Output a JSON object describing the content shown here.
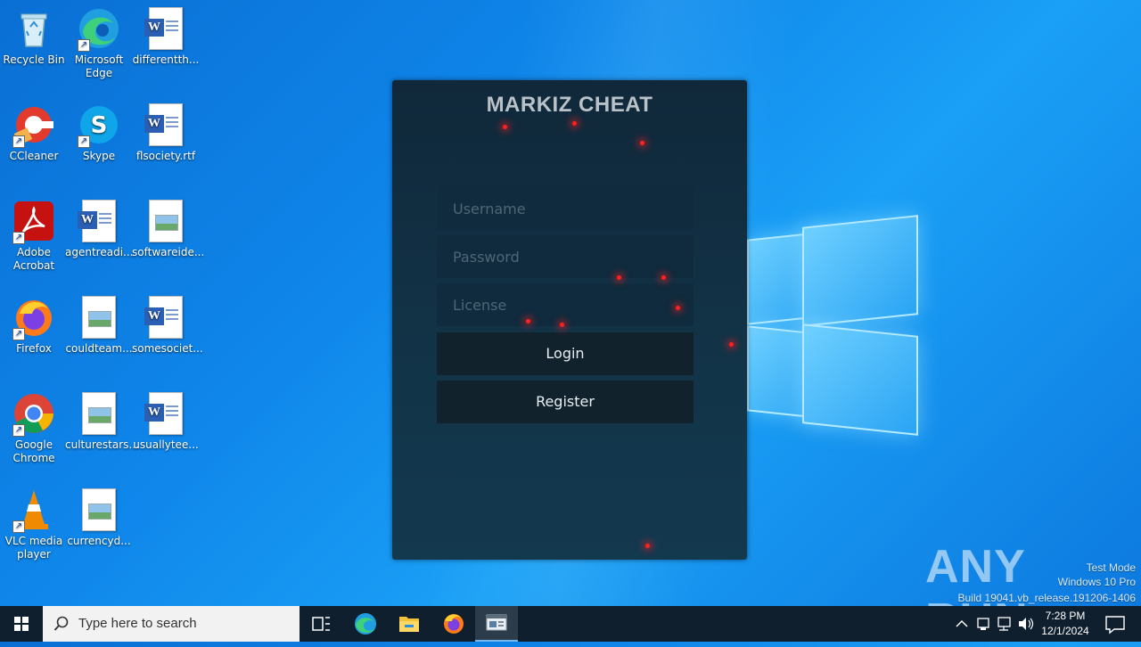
{
  "desktop": {
    "icons": [
      {
        "label": "Recycle Bin"
      },
      {
        "label": "Microsoft Edge"
      },
      {
        "label": "differentth..."
      },
      {
        "label": "CCleaner"
      },
      {
        "label": "Skype"
      },
      {
        "label": "flsociety.rtf"
      },
      {
        "label": "Adobe Acrobat"
      },
      {
        "label": "agentreadi..."
      },
      {
        "label": "softwareide..."
      },
      {
        "label": "Firefox"
      },
      {
        "label": "couldteam..."
      },
      {
        "label": "somesociet..."
      },
      {
        "label": "Google Chrome"
      },
      {
        "label": "culturestars..."
      },
      {
        "label": "usuallytee..."
      },
      {
        "label": "VLC media player"
      },
      {
        "label": "currencyd..."
      }
    ]
  },
  "login": {
    "title": "MARKIZ CHEAT",
    "username_placeholder": "Username",
    "password_placeholder": "Password",
    "license_placeholder": "License",
    "login_label": "Login",
    "register_label": "Register"
  },
  "watermark": {
    "brand": "ANY RUN",
    "line1": "Test Mode",
    "line2": "Windows 10 Pro",
    "line3": "Build 19041.vb_release.191206-1406"
  },
  "taskbar": {
    "search_placeholder": "Type here to search",
    "time": "7:28 PM",
    "date": "12/1/2024"
  },
  "colors": {
    "accent_dot": "#ff2020",
    "panel": "#123246",
    "taskbar": "#0f1f2e"
  }
}
